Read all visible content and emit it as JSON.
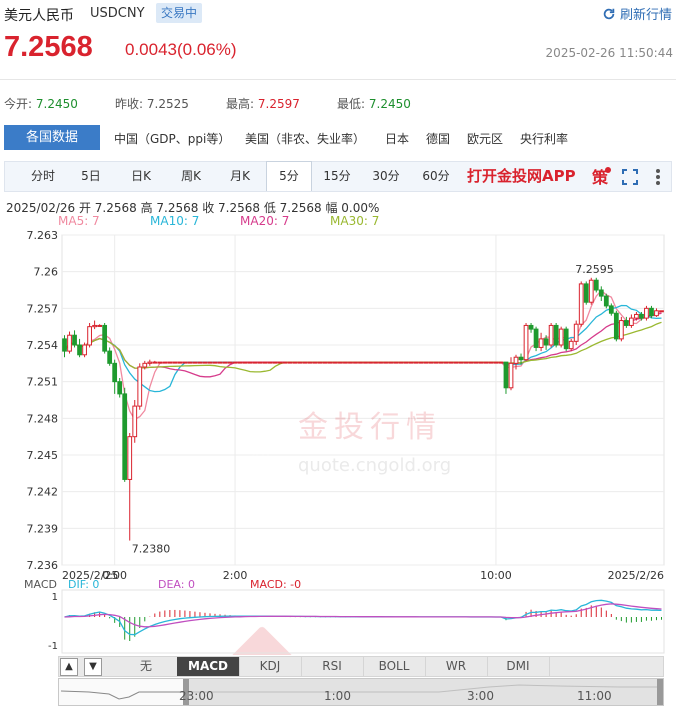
{
  "header": {
    "name": "美元人民币",
    "code": "USDCNY",
    "status": "交易中",
    "refresh_label": "刷新行情"
  },
  "quote": {
    "price": "7.2568",
    "change": "0.0043(0.06%)",
    "timestamp": "2025-02-26 11:50:44"
  },
  "stats": {
    "open_label": "今开:",
    "open": "7.2450",
    "prev_label": "昨收:",
    "prev": "7.2525",
    "high_label": "最高:",
    "high": "7.2597",
    "low_label": "最低:",
    "low": "7.2450"
  },
  "data_tabs": {
    "active": "各国数据",
    "items": [
      "中国（GDP、ppi等）",
      "美国（非农、失业率）",
      "日本",
      "德国",
      "欧元区",
      "央行利率"
    ]
  },
  "periods": {
    "items": [
      "分时",
      "5日",
      "日K",
      "周K",
      "月K",
      "5分",
      "15分",
      "30分",
      "60分"
    ],
    "active_index": 5,
    "app_link": "打开金投网APP"
  },
  "ohlc_line": "2025/02/26  开 7.2568  高 7.2568  收 7.2568  低 7.2568  幅 0.00%",
  "ma_legend": [
    {
      "label": "MA5: 7",
      "color": "#f08aa0"
    },
    {
      "label": "MA10: 7",
      "color": "#29b6d8"
    },
    {
      "label": "MA20: 7",
      "color": "#d63c8c"
    },
    {
      "label": "MA30: 7",
      "color": "#9ab830"
    }
  ],
  "watermark": {
    "brand": "金投行情",
    "url": "quote.cngold.org"
  },
  "chart_data": {
    "type": "candlestick",
    "y_ticks": [
      "7.263",
      "7.26",
      "7.257",
      "7.254",
      "7.251",
      "7.248",
      "7.245",
      "7.242",
      "7.239",
      "7.236"
    ],
    "ylim": [
      7.236,
      7.263
    ],
    "x_labels": [
      "2025/2/25",
      "0:00",
      "2:00",
      "10:00",
      "2025/2/26"
    ],
    "annotations": {
      "high": "7.2595",
      "low": "7.2380"
    },
    "up_color": "#d9232e",
    "down_color": "#1e9a2e",
    "candles": [
      [
        7.2545,
        7.2535,
        7.2548,
        7.253
      ],
      [
        7.2535,
        7.2548,
        7.2551,
        7.2533
      ],
      [
        7.2548,
        7.254,
        7.2552,
        7.2538
      ],
      [
        7.254,
        7.2532,
        7.2545,
        7.253
      ],
      [
        7.2532,
        7.254,
        7.2542,
        7.253
      ],
      [
        7.254,
        7.2555,
        7.2558,
        7.2538
      ],
      [
        7.2555,
        7.2556,
        7.256,
        7.2553
      ],
      [
        7.2556,
        7.2556,
        7.2557,
        7.2555
      ],
      [
        7.2556,
        7.2535,
        7.2558,
        7.2533
      ],
      [
        7.2535,
        7.2525,
        7.2538,
        7.2523
      ],
      [
        7.2525,
        7.251,
        7.2528,
        7.25
      ],
      [
        7.251,
        7.25,
        7.2513,
        7.2497
      ],
      [
        7.25,
        7.243,
        7.2505,
        7.2428
      ],
      [
        7.243,
        7.2465,
        7.2468,
        7.238
      ],
      [
        7.2465,
        7.249,
        7.2495,
        7.246
      ],
      [
        7.249,
        7.2522,
        7.2525,
        7.2487
      ],
      [
        7.2522,
        7.2525,
        7.2527,
        7.252
      ],
      [
        7.2525,
        7.2526,
        7.2528,
        7.2523
      ],
      [
        7.2526,
        7.2526,
        7.2527,
        7.2525
      ],
      [
        7.2526,
        7.2526,
        7.2526,
        7.2526
      ],
      [
        7.2526,
        7.2526,
        7.2526,
        7.2526
      ],
      [
        7.2526,
        7.2526,
        7.2526,
        7.2526
      ],
      [
        7.2526,
        7.2526,
        7.2526,
        7.2526
      ],
      [
        7.2526,
        7.2526,
        7.2526,
        7.2526
      ],
      [
        7.2526,
        7.2526,
        7.2526,
        7.2526
      ],
      [
        7.2526,
        7.2526,
        7.2526,
        7.2526
      ],
      [
        7.2526,
        7.2526,
        7.2526,
        7.2526
      ],
      [
        7.2526,
        7.2526,
        7.2526,
        7.2526
      ],
      [
        7.2526,
        7.2526,
        7.2526,
        7.2526
      ],
      [
        7.2526,
        7.2526,
        7.2526,
        7.2526
      ],
      [
        7.2526,
        7.2526,
        7.2526,
        7.2526
      ],
      [
        7.2526,
        7.2526,
        7.2526,
        7.2526
      ],
      [
        7.2526,
        7.2526,
        7.2526,
        7.2526
      ],
      [
        7.2526,
        7.2526,
        7.2526,
        7.2526
      ],
      [
        7.2526,
        7.2526,
        7.2526,
        7.2526
      ],
      [
        7.2526,
        7.2526,
        7.2526,
        7.2526
      ],
      [
        7.2526,
        7.2526,
        7.2526,
        7.2526
      ],
      [
        7.2526,
        7.2526,
        7.2526,
        7.2526
      ],
      [
        7.2526,
        7.2526,
        7.2526,
        7.2526
      ],
      [
        7.2526,
        7.2526,
        7.2526,
        7.2526
      ],
      [
        7.2526,
        7.2526,
        7.2526,
        7.2526
      ],
      [
        7.2526,
        7.2526,
        7.2526,
        7.2526
      ],
      [
        7.2526,
        7.2526,
        7.2526,
        7.2526
      ],
      [
        7.2526,
        7.2526,
        7.2526,
        7.2526
      ],
      [
        7.2526,
        7.2526,
        7.2526,
        7.2526
      ],
      [
        7.2526,
        7.2526,
        7.2526,
        7.2526
      ],
      [
        7.2526,
        7.2526,
        7.2526,
        7.2526
      ],
      [
        7.2526,
        7.2526,
        7.2526,
        7.2526
      ],
      [
        7.2526,
        7.2526,
        7.2526,
        7.2526
      ],
      [
        7.2526,
        7.2526,
        7.2526,
        7.2526
      ],
      [
        7.2526,
        7.2526,
        7.2526,
        7.2526
      ],
      [
        7.2526,
        7.2526,
        7.2526,
        7.2526
      ],
      [
        7.2526,
        7.2526,
        7.2526,
        7.2526
      ],
      [
        7.2526,
        7.2526,
        7.2526,
        7.2526
      ],
      [
        7.2526,
        7.2526,
        7.2526,
        7.2526
      ],
      [
        7.2526,
        7.2526,
        7.2526,
        7.2526
      ],
      [
        7.2526,
        7.2526,
        7.2526,
        7.2526
      ],
      [
        7.2526,
        7.2526,
        7.2526,
        7.2526
      ],
      [
        7.2526,
        7.2526,
        7.2526,
        7.2526
      ],
      [
        7.2526,
        7.2526,
        7.2526,
        7.2526
      ],
      [
        7.2526,
        7.2526,
        7.2526,
        7.2526
      ],
      [
        7.2526,
        7.2526,
        7.2526,
        7.2526
      ],
      [
        7.2526,
        7.2526,
        7.2526,
        7.2526
      ],
      [
        7.2526,
        7.2526,
        7.2526,
        7.2526
      ],
      [
        7.2526,
        7.2526,
        7.2526,
        7.2526
      ],
      [
        7.2526,
        7.2526,
        7.2526,
        7.2526
      ],
      [
        7.2526,
        7.2526,
        7.2526,
        7.2526
      ],
      [
        7.2526,
        7.2526,
        7.2526,
        7.2526
      ],
      [
        7.2526,
        7.2526,
        7.2526,
        7.2526
      ],
      [
        7.2526,
        7.2526,
        7.2526,
        7.2526
      ],
      [
        7.2526,
        7.2526,
        7.2526,
        7.2526
      ],
      [
        7.2526,
        7.2526,
        7.2526,
        7.2526
      ],
      [
        7.2526,
        7.2526,
        7.2526,
        7.2526
      ],
      [
        7.2526,
        7.2526,
        7.2526,
        7.2526
      ],
      [
        7.2526,
        7.2526,
        7.2526,
        7.2526
      ],
      [
        7.2526,
        7.2526,
        7.2526,
        7.2526
      ],
      [
        7.2526,
        7.2526,
        7.2526,
        7.2526
      ],
      [
        7.2526,
        7.2526,
        7.2526,
        7.2526
      ],
      [
        7.2526,
        7.2526,
        7.2526,
        7.2526
      ],
      [
        7.2526,
        7.2526,
        7.2526,
        7.2526
      ],
      [
        7.2526,
        7.2526,
        7.2526,
        7.2526
      ],
      [
        7.2526,
        7.2526,
        7.2526,
        7.2526
      ],
      [
        7.2526,
        7.2526,
        7.2526,
        7.2526
      ],
      [
        7.2526,
        7.2526,
        7.2526,
        7.2526
      ],
      [
        7.2526,
        7.2526,
        7.2526,
        7.2526
      ],
      [
        7.2526,
        7.2526,
        7.2526,
        7.2526
      ],
      [
        7.2526,
        7.2526,
        7.2526,
        7.2526
      ],
      [
        7.2526,
        7.2526,
        7.2526,
        7.2526
      ],
      [
        7.2526,
        7.2505,
        7.2526,
        7.25
      ],
      [
        7.2505,
        7.2525,
        7.253,
        7.2503
      ],
      [
        7.2525,
        7.253,
        7.2532,
        7.252
      ],
      [
        7.253,
        7.2528,
        7.2533,
        7.2524
      ],
      [
        7.2528,
        7.2556,
        7.2558,
        7.2527
      ],
      [
        7.2556,
        7.2553,
        7.2558,
        7.255
      ],
      [
        7.2553,
        7.2538,
        7.2555,
        7.2535
      ],
      [
        7.2538,
        7.2545,
        7.255,
        7.2535
      ],
      [
        7.2545,
        7.254,
        7.2548,
        7.2536
      ],
      [
        7.254,
        7.2556,
        7.2558,
        7.2538
      ],
      [
        7.2556,
        7.254,
        7.2558,
        7.2538
      ],
      [
        7.254,
        7.2553,
        7.2555,
        7.2538
      ],
      [
        7.2553,
        7.2537,
        7.2555,
        7.2535
      ],
      [
        7.2537,
        7.2543,
        7.2545,
        7.2535
      ],
      [
        7.2543,
        7.2557,
        7.256,
        7.254
      ],
      [
        7.2557,
        7.259,
        7.2592,
        7.2555
      ],
      [
        7.259,
        7.2575,
        7.2592,
        7.2573
      ],
      [
        7.2575,
        7.2593,
        7.2595,
        7.2573
      ],
      [
        7.2593,
        7.2585,
        7.2595,
        7.2583
      ],
      [
        7.2585,
        7.258,
        7.2588,
        7.2576
      ],
      [
        7.258,
        7.2572,
        7.2582,
        7.257
      ],
      [
        7.2572,
        7.2566,
        7.2574,
        7.2564
      ],
      [
        7.2566,
        7.2545,
        7.2568,
        7.2543
      ],
      [
        7.2545,
        7.256,
        7.2563,
        7.2543
      ],
      [
        7.256,
        7.2556,
        7.2563,
        7.2554
      ],
      [
        7.2556,
        7.2562,
        7.2565,
        7.2554
      ],
      [
        7.2562,
        7.2565,
        7.2567,
        7.256
      ],
      [
        7.2565,
        7.2562,
        7.2567,
        7.256
      ],
      [
        7.2562,
        7.257,
        7.2572,
        7.256
      ],
      [
        7.257,
        7.2564,
        7.2572,
        7.2562
      ],
      [
        7.2564,
        7.2568,
        7.257,
        7.2563
      ],
      [
        7.2568,
        7.2568,
        7.2568,
        7.2568
      ]
    ]
  },
  "macd": {
    "legend": {
      "name": "MACD",
      "dif": "DIF: 0",
      "dea": "DEA: 0",
      "macd": "MACD: -0"
    },
    "y_ticks": [
      "1",
      "-1"
    ]
  },
  "indicator_tabs": {
    "items": [
      "无",
      "MACD",
      "KDJ",
      "RSI",
      "BOLL",
      "WR",
      "DMI"
    ],
    "active_index": 1
  },
  "navigator": {
    "labels": [
      "23:00",
      "1:00",
      "3:00",
      "11:00"
    ]
  }
}
